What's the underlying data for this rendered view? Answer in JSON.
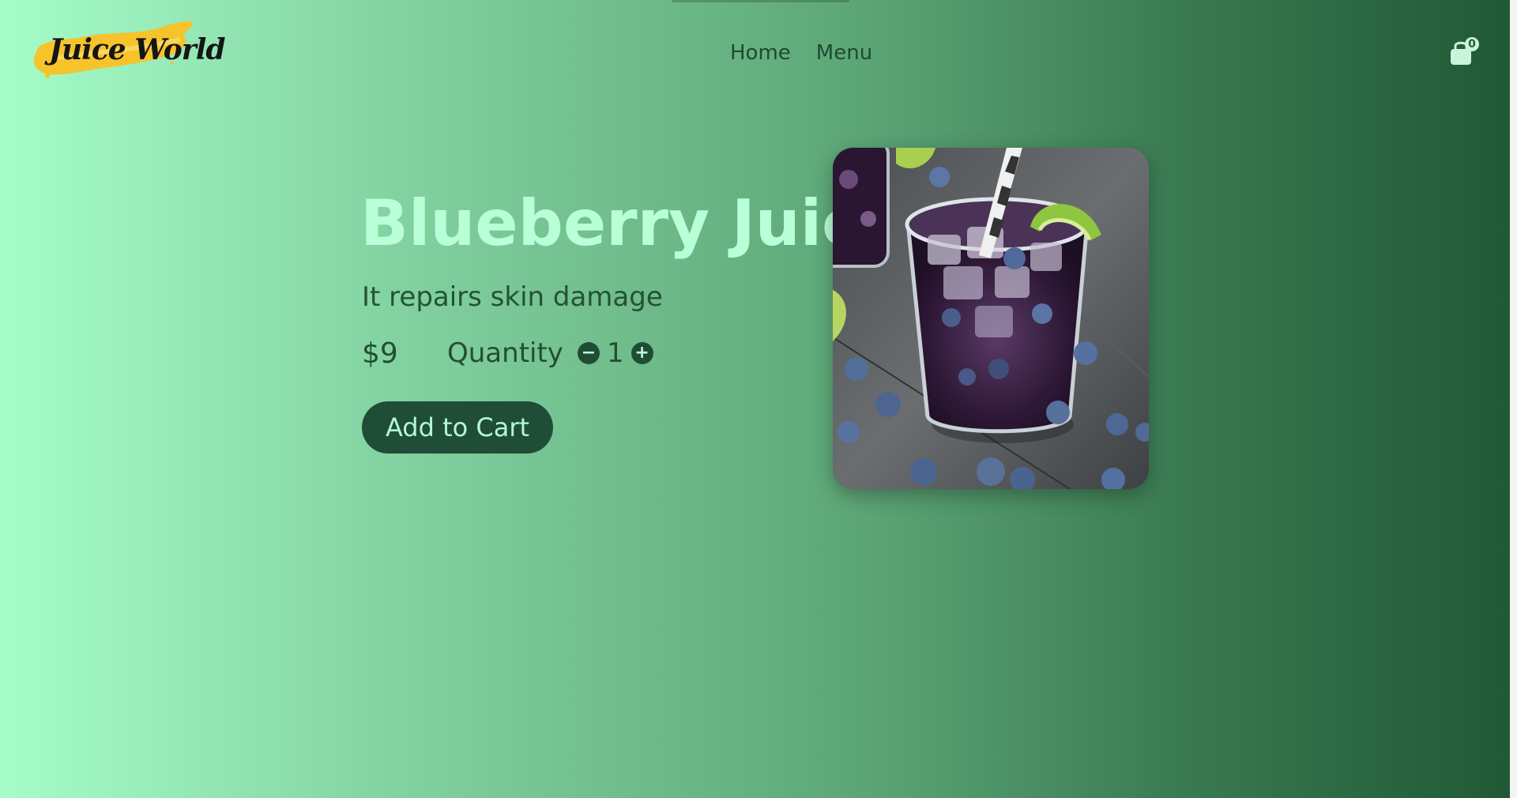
{
  "header": {
    "logo_text": "Juice World",
    "nav": [
      {
        "label": "Home"
      },
      {
        "label": "Menu"
      }
    ],
    "cart": {
      "icon": "shopping-bag-icon",
      "count": "0"
    }
  },
  "product": {
    "title": "Blueberry Juice",
    "description": "It repairs skin damage",
    "price": "$9",
    "quantity_label": "Quantity",
    "quantity": "1",
    "decrease_icon": "minus-icon",
    "increase_icon": "plus-icon",
    "add_to_cart_label": "Add to Cart",
    "image_icon": "blueberry-juice-photo"
  },
  "colors": {
    "accent_dark": "#1f4d37",
    "title_mint": "#b9ffd8",
    "gradient_start": "#a5fdc9",
    "gradient_end": "#1f5835"
  }
}
